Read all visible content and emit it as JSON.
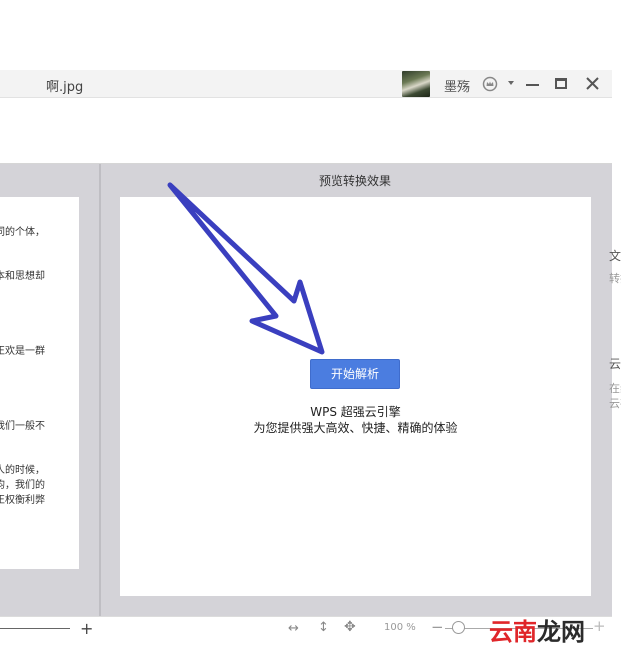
{
  "window": {
    "title": "啊.jpg",
    "user_name": "墨殇",
    "icons": [
      "vip-crown-icon",
      "dropdown-icon",
      "minimize-icon",
      "maximize-icon",
      "close-icon"
    ]
  },
  "left_page": {
    "lines": [
      "同的个体，",
      "本和思想却",
      "正欢是一群",
      "我们一般不",
      "人的时候，",
      "均，我们的",
      "正权衡利弊"
    ]
  },
  "preview": {
    "header": "预览转换效果",
    "start_button": "开始解析",
    "engine_title": "WPS 超强云引擎",
    "engine_desc": "为您提供强大高效、快捷、精确的体验"
  },
  "side": {
    "lines": [
      "文档",
      "转换",
      "云文",
      "在线",
      "云存"
    ]
  },
  "statusbar": {
    "zoom": "100 %",
    "plus": "+",
    "minus": "−"
  },
  "watermark": {
    "part1": "云南",
    "part2": "龙网"
  },
  "colors": {
    "accent_button": "#4b7de0",
    "arrow": "#3a3fbf",
    "pane_bg": "#d4d3d8"
  }
}
